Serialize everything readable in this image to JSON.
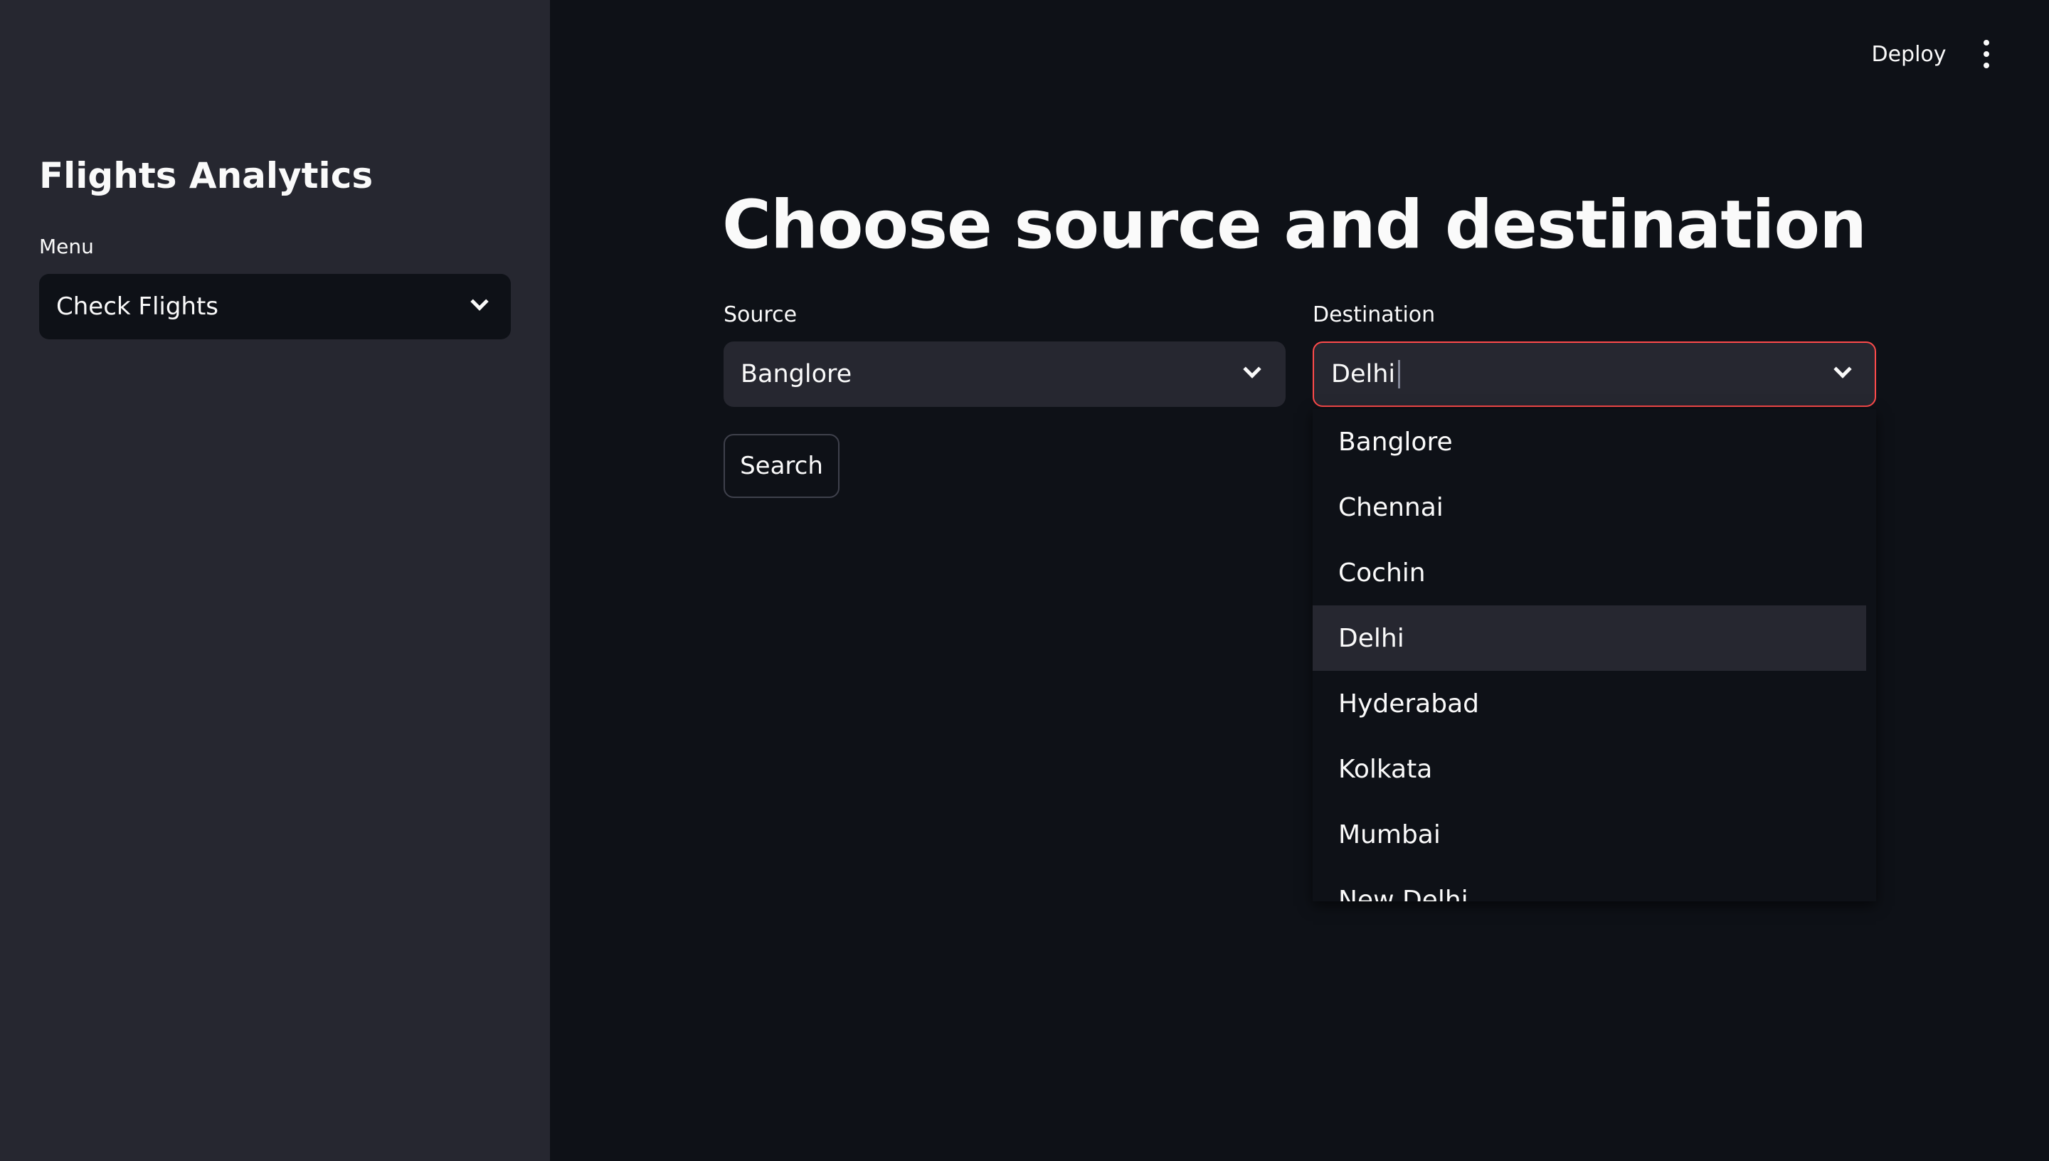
{
  "sidebar": {
    "title": "Flights Analytics",
    "menu_label": "Menu",
    "menu_selected": "Check Flights"
  },
  "header": {
    "deploy_label": "Deploy"
  },
  "main": {
    "title": "Choose source and destination",
    "source": {
      "label": "Source",
      "value": "Banglore"
    },
    "destination": {
      "label": "Destination",
      "value": "Delhi"
    },
    "search_label": "Search"
  },
  "dropdown": {
    "highlighted": "Delhi",
    "options": [
      "Banglore",
      "Chennai",
      "Cochin",
      "Delhi",
      "Hyderabad",
      "Kolkata",
      "Mumbai",
      "New Delhi"
    ]
  },
  "colors": {
    "background": "#0e1117",
    "sidebar": "#262730",
    "focus_border": "#ff4b4b",
    "text": "#fafafa"
  }
}
